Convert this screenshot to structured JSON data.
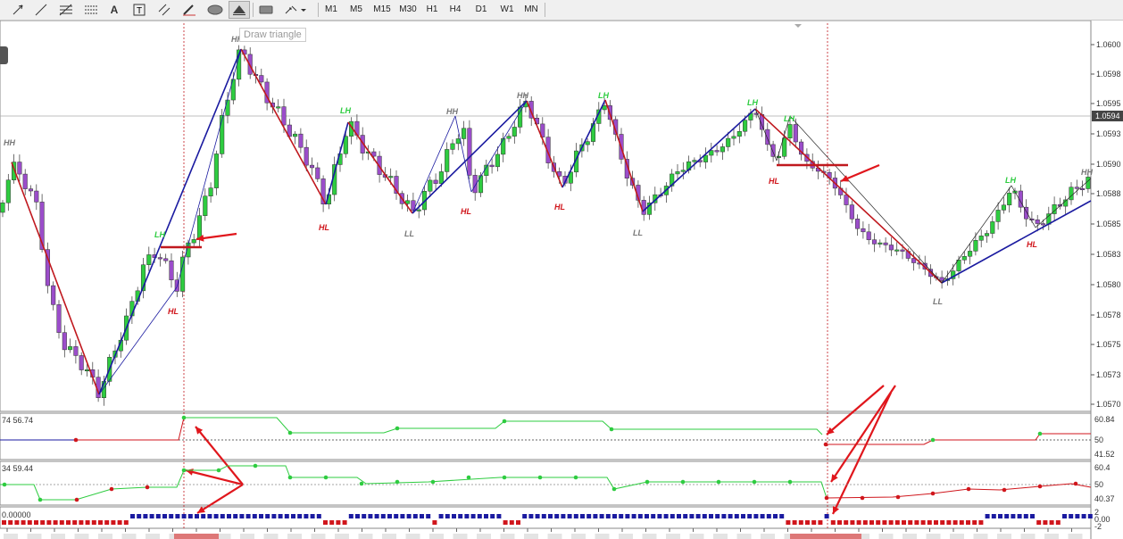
{
  "toolbar": {
    "timeframes": [
      "M1",
      "M5",
      "M15",
      "M30",
      "H1",
      "H4",
      "D1",
      "W1",
      "MN"
    ],
    "tooltip": "Draw triangle",
    "tools": [
      "cursor-icon",
      "line-icon",
      "fibonacci-icon",
      "fibo-fan-icon",
      "text-icon",
      "text-label-icon",
      "channel-icon",
      "pencil-icon",
      "ellipse-icon",
      "triangle-icon",
      "rectangle-icon",
      "arrows-icon"
    ]
  },
  "colors": {
    "bull": "#2ecc40",
    "bear": "#9b4dca",
    "zigzag_up": "#1a1aa0",
    "zigzag_down": "#c0181e",
    "arrow": "#e0161c",
    "hh": "#777777",
    "lh": "#2ecc40",
    "hl": "#d0161c",
    "ll": "#777777"
  },
  "price_axis": {
    "labels": [
      "1.0600",
      "1.0598",
      "1.0595",
      "1.0593",
      "1.0590",
      "1.0588",
      "1.0585",
      "1.0583",
      "1.0580",
      "1.0578",
      "1.0575",
      "1.0573",
      "1.0570"
    ],
    "current": "1.0594"
  },
  "swing_labels": {
    "hh": "HH",
    "lh": "LH",
    "hl": "HL",
    "ll": "LL"
  },
  "indicators": {
    "ind1": {
      "label": "74 56.74",
      "levels": [
        "60.84",
        "50",
        "41.52"
      ]
    },
    "ind2": {
      "label": "34 59.44",
      "levels": [
        "60.4",
        "50",
        "40.37"
      ]
    },
    "ind3": {
      "label": "0.00000",
      "levels": [
        "2",
        "0.00",
        "-2"
      ]
    }
  }
}
